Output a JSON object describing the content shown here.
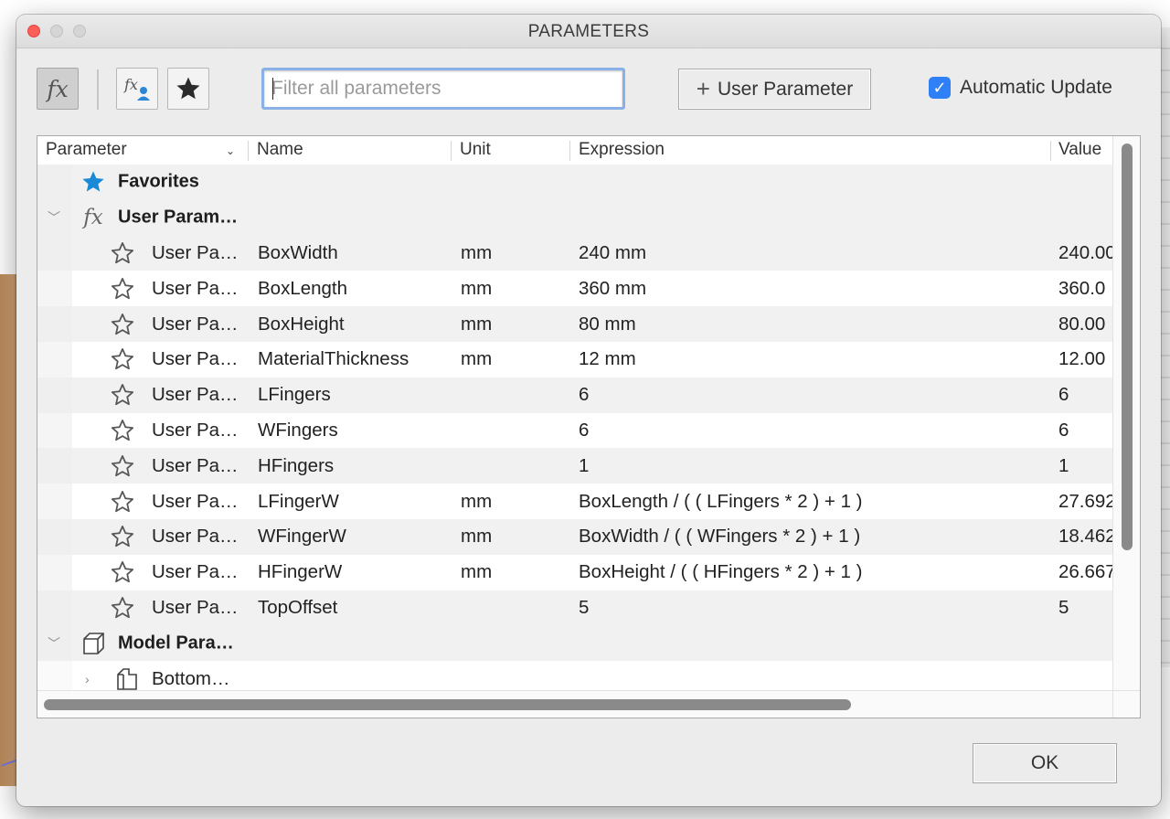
{
  "window": {
    "title": "PARAMETERS"
  },
  "toolbar": {
    "fx_button": "fx",
    "filter_placeholder": "Filter all parameters",
    "filter_value": "",
    "add_user_param_label": "User Parameter",
    "auto_update_label": "Automatic Update",
    "auto_update_checked": true
  },
  "columns": {
    "parameter": "Parameter",
    "name": "Name",
    "unit": "Unit",
    "expression": "Expression",
    "value": "Value"
  },
  "groups": {
    "favorites": "Favorites",
    "user_params": "User Param…",
    "model_params": "Model Para…",
    "bottom": "Bottom…"
  },
  "rows": [
    {
      "param": "User Pa…",
      "name": "BoxWidth",
      "unit": "mm",
      "expression": "240 mm",
      "value": "240.00"
    },
    {
      "param": "User Pa…",
      "name": "BoxLength",
      "unit": "mm",
      "expression": "360 mm",
      "value": "360.0"
    },
    {
      "param": "User Pa…",
      "name": "BoxHeight",
      "unit": "mm",
      "expression": "80 mm",
      "value": "80.00"
    },
    {
      "param": "User Pa…",
      "name": "MaterialThickness",
      "unit": "mm",
      "expression": "12 mm",
      "value": "12.00"
    },
    {
      "param": "User Pa…",
      "name": "LFingers",
      "unit": "",
      "expression": "6",
      "value": "6"
    },
    {
      "param": "User Pa…",
      "name": "WFingers",
      "unit": "",
      "expression": "6",
      "value": "6"
    },
    {
      "param": "User Pa…",
      "name": "HFingers",
      "unit": "",
      "expression": "1",
      "value": "1"
    },
    {
      "param": "User Pa…",
      "name": "LFingerW",
      "unit": "mm",
      "expression": "BoxLength / ( ( LFingers * 2 ) + 1 )",
      "value": "27.692"
    },
    {
      "param": "User Pa…",
      "name": "WFingerW",
      "unit": "mm",
      "expression": "BoxWidth / ( ( WFingers * 2 ) + 1 )",
      "value": "18.462"
    },
    {
      "param": "User Pa…",
      "name": "HFingerW",
      "unit": "mm",
      "expression": "BoxHeight / ( ( HFingers * 2 ) + 1 )",
      "value": "26.667"
    },
    {
      "param": "User Pa…",
      "name": "TopOffset",
      "unit": "",
      "expression": "5",
      "value": "5"
    }
  ],
  "footer": {
    "ok_label": "OK"
  },
  "colors": {
    "accent": "#2f7ff7",
    "favorites_star": "#1a8ad6",
    "close": "#fc5f57"
  }
}
